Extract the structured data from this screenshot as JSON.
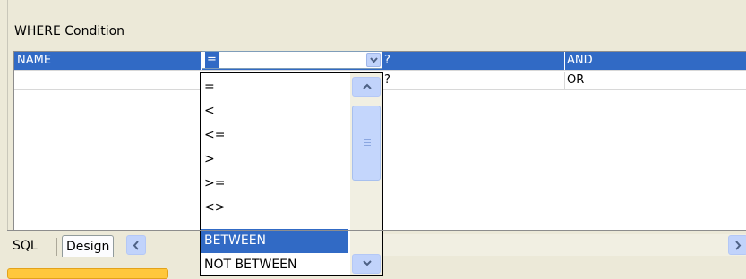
{
  "section_title": "WHERE Condition",
  "grid": {
    "rows": [
      {
        "field": "NAME",
        "operator": "=",
        "value": "?",
        "logic": "AND"
      },
      {
        "field": "",
        "operator": "",
        "value": "?",
        "logic": "OR"
      }
    ]
  },
  "operator_combo": {
    "selected_value": "="
  },
  "operator_dropdown": {
    "items": [
      "=",
      "<",
      "<=",
      ">",
      ">=",
      "<>",
      "BETWEEN",
      "NOT BETWEEN"
    ],
    "highlighted": "BETWEEN"
  },
  "tabs": {
    "sql_label": "SQL",
    "design_label": "Design"
  },
  "colors": {
    "selection": "#316ac5",
    "scroll_button": "#c1d3fb",
    "window_bg": "#ece9d8",
    "tab_accent": "#ffc73c"
  },
  "icons": {
    "combo_button": "chevron-down-icon",
    "scroll_up": "chevron-up-icon",
    "scroll_down": "chevron-down-icon",
    "scroll_left": "chevron-left-icon",
    "scroll_right": "chevron-right-icon"
  }
}
